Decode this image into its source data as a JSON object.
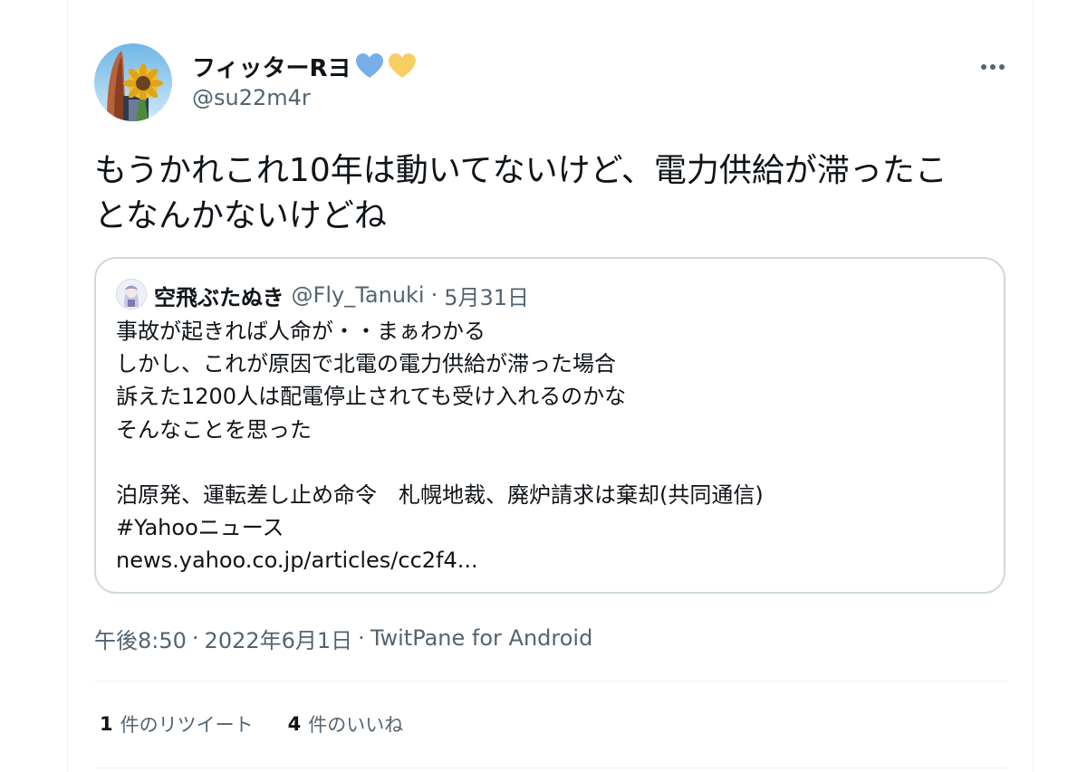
{
  "tweet": {
    "display_name": "フィッターRヨ",
    "handle": "@su22m4r",
    "heart_colors": [
      "#78aee7",
      "#f6cf63"
    ],
    "text_lines": [
      "もうかれこれ10年は動いてないけど、電力供給が滞ったこ",
      "となんかないけどね"
    ]
  },
  "quote": {
    "name": "空飛ぶたぬき",
    "handle": "@Fly_Tanuki",
    "separator": "·",
    "date": "5月31日",
    "lines": [
      "事故が起きれば人命が・・まぁわかる",
      "しかし、これが原因で北電の電力供給が滞った場合",
      "訴えた1200人は配電停止されても受け入れるのかな",
      "そんなことを思った",
      "",
      "泊原発、運転差し止め命令　札幌地裁、廃炉請求は棄却(共同通信)",
      "#Yahooニュース",
      "news.yahoo.co.jp/articles/cc2f4..."
    ]
  },
  "meta": {
    "time": "午後8:50",
    "separator": "·",
    "date": "2022年6月1日",
    "source": "TwitPane for Android"
  },
  "stats": {
    "retweets_count": "1",
    "retweets_label": "件のリツイート",
    "likes_count": "4",
    "likes_label": "件のいいね"
  },
  "icons": {
    "more": "more-horizontal-icon",
    "hearts": [
      "blue-heart-icon",
      "yellow-heart-icon"
    ]
  }
}
